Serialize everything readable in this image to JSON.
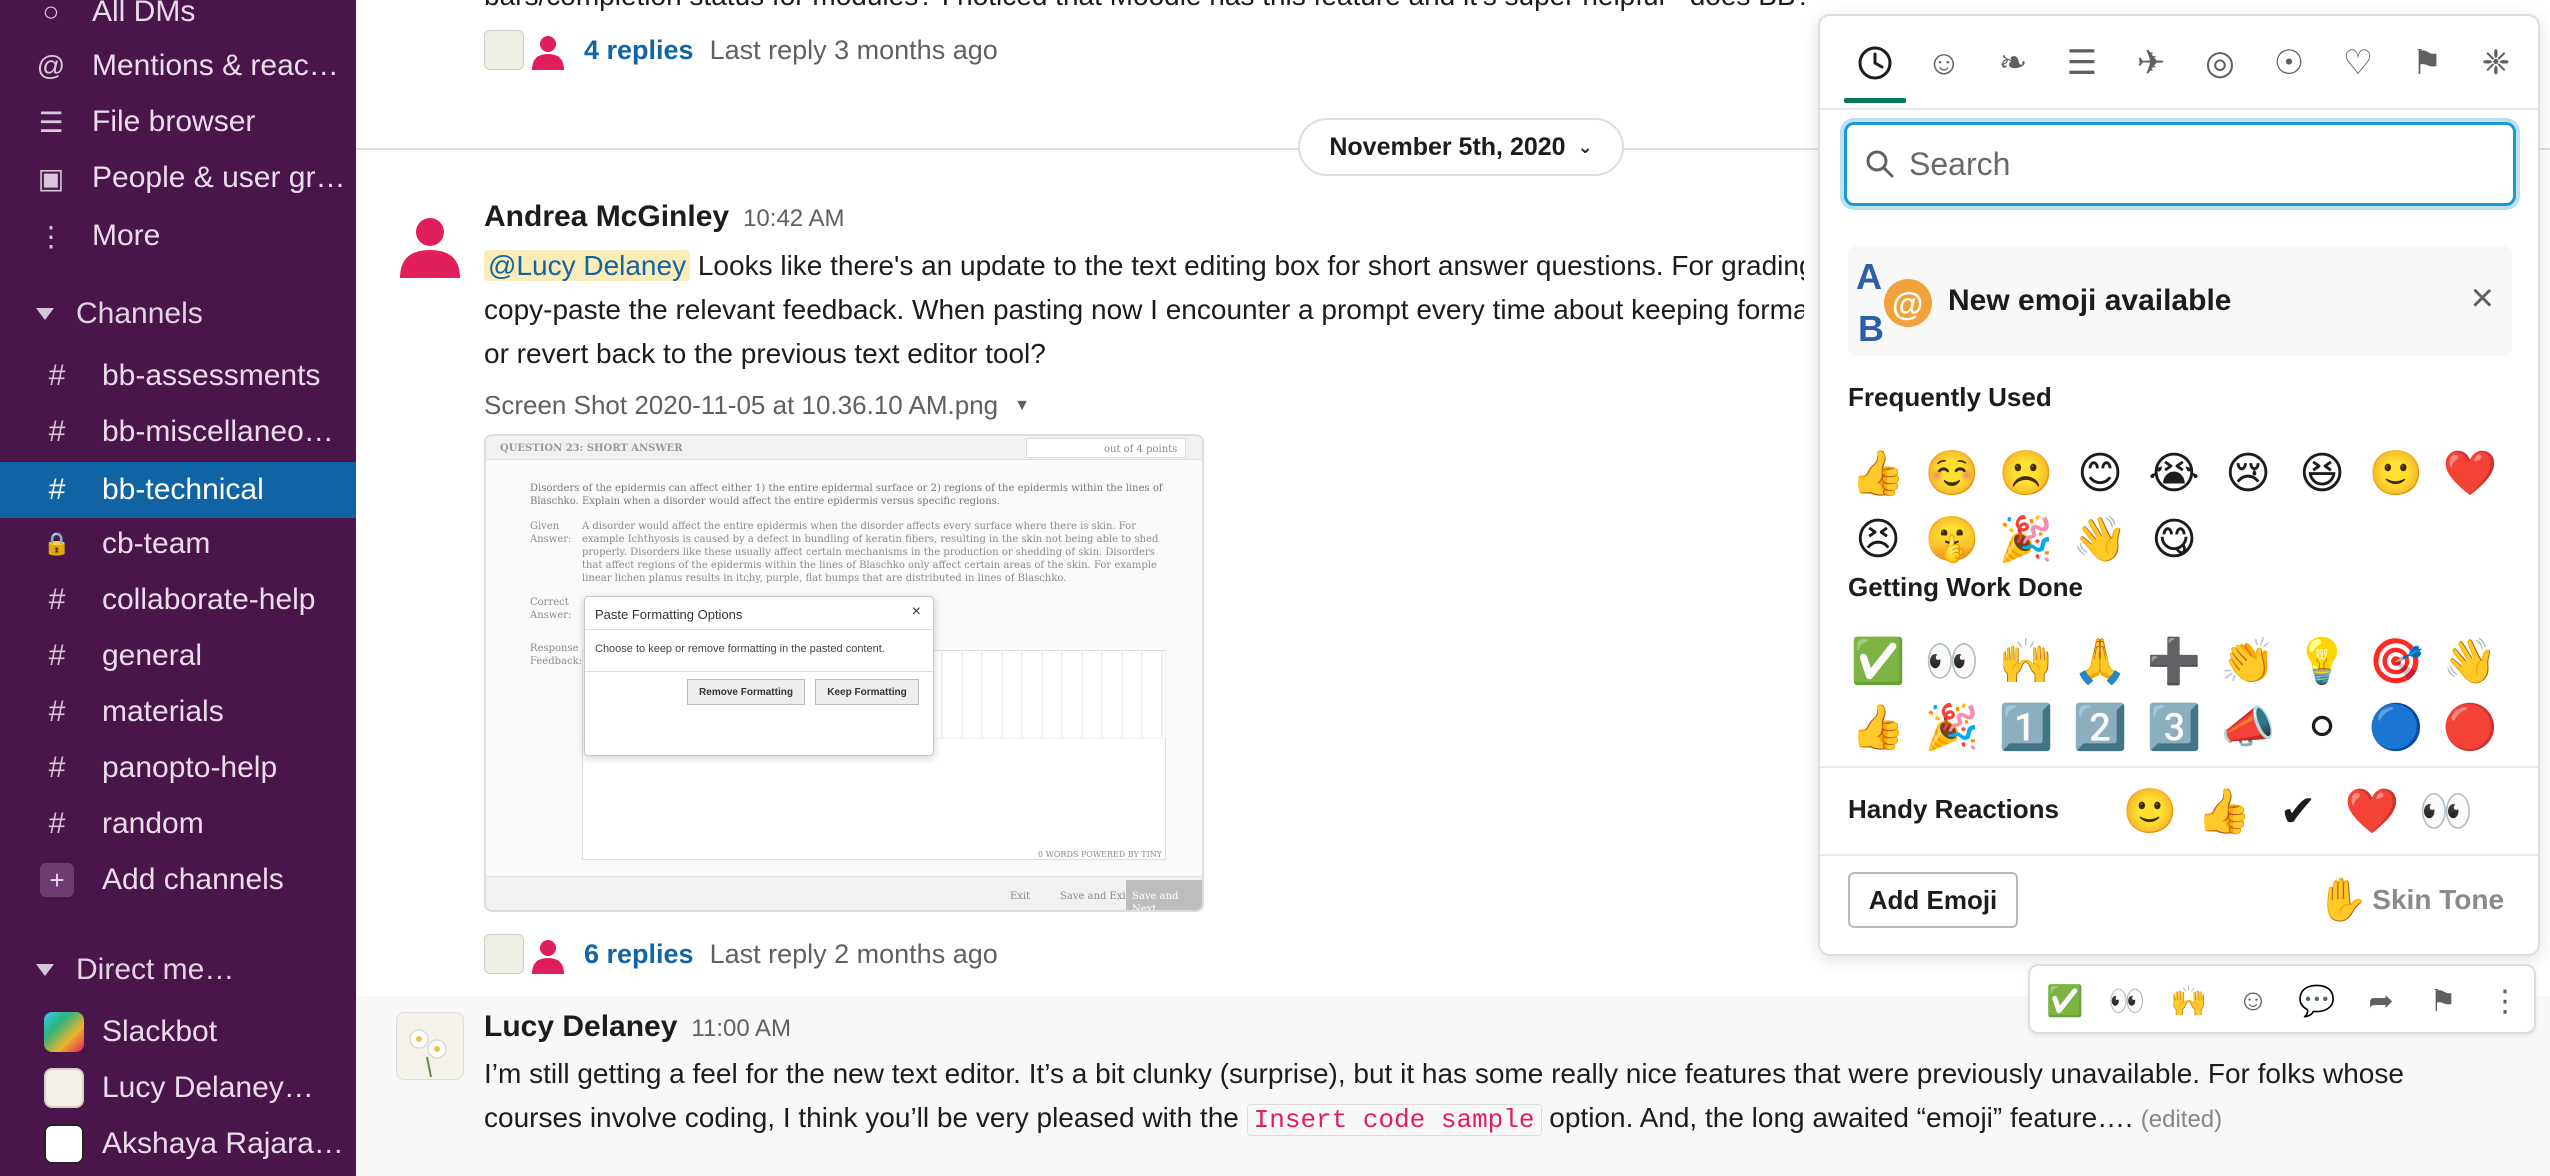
{
  "sidebar": {
    "top_items": [
      {
        "label": "All DMs",
        "icon": "dms-icon"
      },
      {
        "label": "Mentions & reac…",
        "icon": "at-icon"
      },
      {
        "label": "File browser",
        "icon": "layers-icon"
      },
      {
        "label": "People & user gr…",
        "icon": "people-icon"
      },
      {
        "label": "More",
        "icon": "more-vertical-icon"
      }
    ],
    "channels_header": "Channels",
    "channels": [
      {
        "label": "bb-assessments",
        "prefix": "#"
      },
      {
        "label": "bb-miscellaneo…",
        "prefix": "#"
      },
      {
        "label": "bb-technical",
        "prefix": "#",
        "active": true
      },
      {
        "label": "cb-team",
        "prefix": "lock"
      },
      {
        "label": "collaborate-help",
        "prefix": "#"
      },
      {
        "label": "general",
        "prefix": "#"
      },
      {
        "label": "materials",
        "prefix": "#"
      },
      {
        "label": "panopto-help",
        "prefix": "#"
      },
      {
        "label": "random",
        "prefix": "#"
      }
    ],
    "add_channels": "Add channels",
    "dm_header": "Direct me…",
    "dms": [
      {
        "label": "Slackbot"
      },
      {
        "label": "Lucy Delaney…"
      },
      {
        "label": "Akshaya Rajara…"
      }
    ]
  },
  "main": {
    "top_partial_text": "bars/completion status for modules? I noticed that Moodle has this feature and it’s super helpful - does BB?",
    "thread1": {
      "replies": "4 replies",
      "last_reply": "Last reply 3 months ago"
    },
    "date_divider": "November 5th, 2020",
    "msg1": {
      "author": "Andrea McGinley",
      "time": "10:42 AM",
      "mention": "@Lucy Delaney",
      "line1": "Looks like there's an update to the text editing box for short answer questions. For grading, I often",
      "line2": "copy-paste the relevant feedback. When pasting now I encounter a prompt every time about keeping formatting. Can this be turned off",
      "line3": "or revert back to the previous text editor tool?",
      "attachment_name": "Screen Shot 2020-11-05 at 10.36.10 AM.png"
    },
    "thumb": {
      "question_label": "QUESTION 23:   SHORT ANSWER",
      "points": "out of 4 points",
      "question_text": "Disorders of the epidermis can affect either 1) the entire epidermal surface or 2) regions of the epidermis within the lines of Blaschko. Explain when a disorder would affect the entire epidermis versus specific regions.",
      "given_label": "Given Answer:",
      "given_text": "A disorder would affect the entire epidermis when the disorder affects every surface where there is skin. For example Ichthyosis is caused by a defect in bundling of keratin fibers, resulting in the skin not being able to shed properly. Disorders like these usually affect certain mechanisms in the production or shedding of skin. Disorders that affect regions of the epidermis within the lines of Blaschko only affect certain areas of the skin. For example linear lichen planus results in itchy, purple, flat bumps that are distributed in lines of Blaschko.",
      "correct_label": "Correct Answer:",
      "response_label": "Response Feedback:",
      "dialog_title": "Paste Formatting Options",
      "dialog_close": "×",
      "dialog_body": "Choose to keep or remove formatting in the pasted content.",
      "remove_btn": "Remove Formatting",
      "keep_btn": "Keep Formatting",
      "words": "0 WORDS  POWERED BY TINY",
      "exit": "Exit",
      "save_exit": "Save and Exit",
      "save_next": "Save and Next"
    },
    "thread2": {
      "replies": "6 replies",
      "last_reply": "Last reply 2 months ago"
    },
    "msg2": {
      "author": "Lucy Delaney",
      "time": "11:00 AM",
      "line1": "I’m still getting a feel for the new text editor. It’s a bit clunky (surprise), but it has some really nice features that were previously unavailable. For folks whose",
      "line2_pre": "courses involve coding, I think you’ll be very pleased with the",
      "code": "Insert code sample",
      "line2_post": "option. And, the long awaited “emoji” feature….",
      "edited": "(edited)"
    }
  },
  "picker": {
    "tabs": [
      "clock-icon",
      "smiley-icon",
      "leaf-icon",
      "burger-icon",
      "plane-icon",
      "ball-icon",
      "bulb-icon",
      "heart-icon",
      "flag-icon",
      "slack-icon"
    ],
    "tab_glyphs": [
      "⏰",
      "☺",
      "❧",
      "☰",
      "✈",
      "◎",
      "☉",
      "♡",
      "⚑",
      "❈"
    ],
    "search_placeholder": "Search",
    "banner_text": "New emoji available",
    "banner_close": "×",
    "frequently_used_title": "Frequently Used",
    "frequently_used": [
      "👍",
      "☺️",
      "☹️",
      "😊",
      "😭",
      "😢",
      "😆",
      "🙂",
      "❤️",
      "😣",
      "🤫",
      "🎉",
      "👋",
      "😋"
    ],
    "work_title": "Getting Work Done",
    "work": [
      "✅",
      "👀",
      "🙌",
      "🙏",
      "➕",
      "👏",
      "💡",
      "🎯",
      "👋",
      "👍",
      "🎉",
      "1️⃣",
      "2️⃣",
      "3️⃣",
      "📣",
      "⚪",
      "🔵",
      "🔴"
    ],
    "handy_title": "Handy Reactions",
    "handy": [
      "🙂",
      "👍",
      "✔",
      "❤️",
      "👀"
    ],
    "add_emoji": "Add Emoji",
    "skin_tone_glyph": "✋",
    "skin_tone": "Skin Tone"
  },
  "hover_bar": {
    "items": [
      "✅",
      "👀",
      "🙌",
      "☺",
      "💬",
      "➦",
      "⚑",
      "⋮"
    ]
  },
  "colors": {
    "sidebar_bg": "#4a154b",
    "active_channel": "#1164a3",
    "link": "#1264a3",
    "mention_bg": "#fcecb8",
    "code_text": "#e01e5a",
    "tab_underline": "#007a5a",
    "search_focus": "#1d9bd1"
  }
}
